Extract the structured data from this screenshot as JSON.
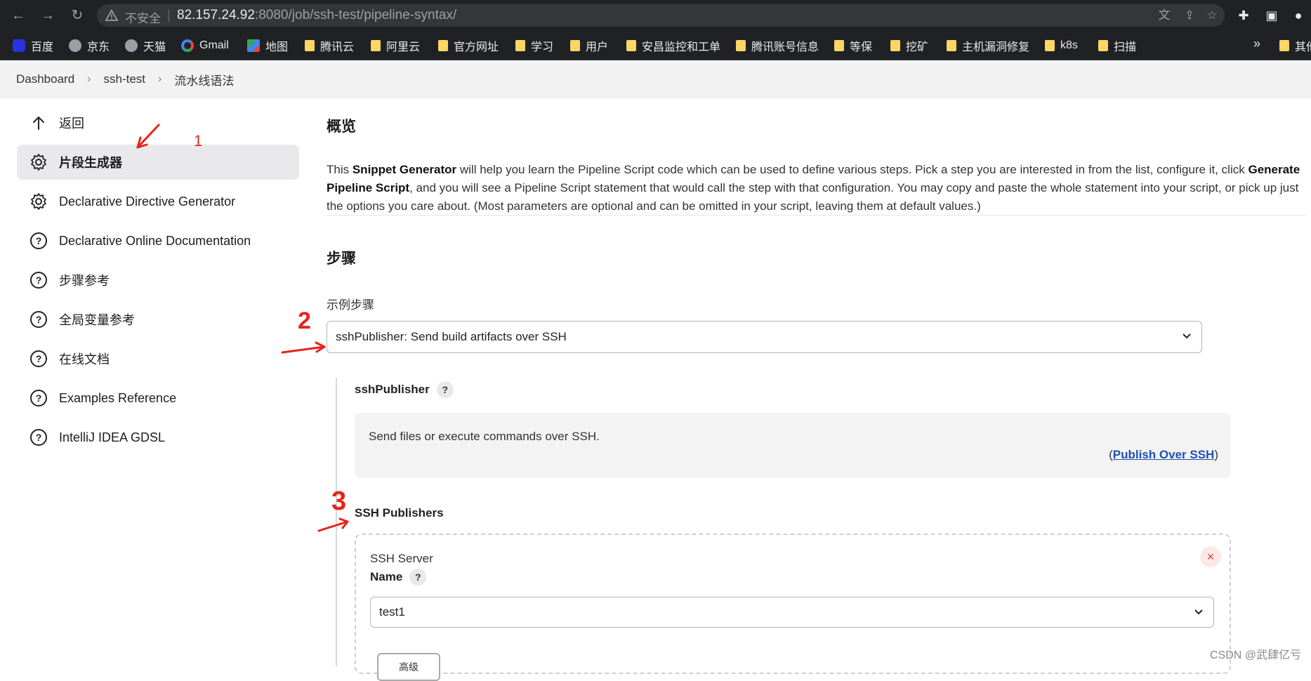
{
  "browser": {
    "insecure_label": "不安全",
    "url_host": "82.157.24.92",
    "url_rest": ":8080/job/ssh-test/pipeline-syntax/",
    "bookmarks": [
      {
        "label": "百度",
        "icon": "baidu-icon"
      },
      {
        "label": "京东",
        "icon": "globe-icon"
      },
      {
        "label": "天猫",
        "icon": "globe-icon"
      },
      {
        "label": "Gmail",
        "icon": "google-icon"
      },
      {
        "label": "地图",
        "icon": "maps-icon"
      },
      {
        "label": "腾讯云",
        "icon": "folder-icon"
      },
      {
        "label": "阿里云",
        "icon": "folder-icon"
      },
      {
        "label": "官方网址",
        "icon": "folder-icon"
      },
      {
        "label": "学习",
        "icon": "folder-icon"
      },
      {
        "label": "用户",
        "icon": "folder-icon"
      },
      {
        "label": "安昌监控和工单",
        "icon": "folder-icon"
      },
      {
        "label": "腾讯账号信息",
        "icon": "folder-icon"
      },
      {
        "label": "等保",
        "icon": "folder-icon"
      },
      {
        "label": "挖矿",
        "icon": "folder-icon"
      },
      {
        "label": "主机漏洞修复",
        "icon": "folder-icon"
      },
      {
        "label": "k8s",
        "icon": "folder-icon"
      },
      {
        "label": "扫描",
        "icon": "folder-icon"
      }
    ],
    "more_label": "»",
    "overflow_label": "其他"
  },
  "breadcrumbs": [
    "Dashboard",
    "ssh-test",
    "流水线语法"
  ],
  "sidebar": {
    "items": [
      {
        "label": "返回",
        "icon": "arrow-up-icon"
      },
      {
        "label": "片段生成器",
        "icon": "gear-icon"
      },
      {
        "label": "Declarative Directive Generator",
        "icon": "gear-icon"
      },
      {
        "label": "Declarative Online Documentation",
        "icon": "help-circle-icon"
      },
      {
        "label": "步骤参考",
        "icon": "help-circle-icon"
      },
      {
        "label": "全局变量参考",
        "icon": "help-circle-icon"
      },
      {
        "label": "在线文档",
        "icon": "help-circle-icon"
      },
      {
        "label": "Examples Reference",
        "icon": "help-circle-icon"
      },
      {
        "label": "IntelliJ IDEA GDSL",
        "icon": "help-circle-icon"
      }
    ]
  },
  "main": {
    "overview_title": "概览",
    "desc_parts": {
      "p1": "This ",
      "b1": "Snippet Generator",
      "p2": " will help you learn the Pipeline Script code which can be used to define various steps. Pick a step you are interested in from the list, configure it, click ",
      "b2": "Generate Pipeline Script",
      "p3": ", and you will see a Pipeline Script statement that would call the step with that configuration. You may copy and paste the whole statement into your script, or pick up just the options you care about. (Most parameters are optional and can be omitted in your script, leaving them at default values.)"
    },
    "steps_title": "步骤",
    "sample_step_label": "示例步骤",
    "sample_step_value": "sshPublisher: Send build artifacts over SSH",
    "step_name": "sshPublisher",
    "help_mark": "?",
    "help_text": "Send files or execute commands over SSH.",
    "help_link_open": "(",
    "help_link": "Publish Over SSH",
    "help_link_close": ")",
    "publishers_title": "SSH Publishers",
    "server_section": "SSH Server",
    "name_label": "Name",
    "name_value": "test1",
    "advanced_label": "高级",
    "close_mark": "×"
  },
  "annotations": [
    "1",
    "2",
    "3"
  ],
  "watermark": "CSDN @武肆亿亏"
}
